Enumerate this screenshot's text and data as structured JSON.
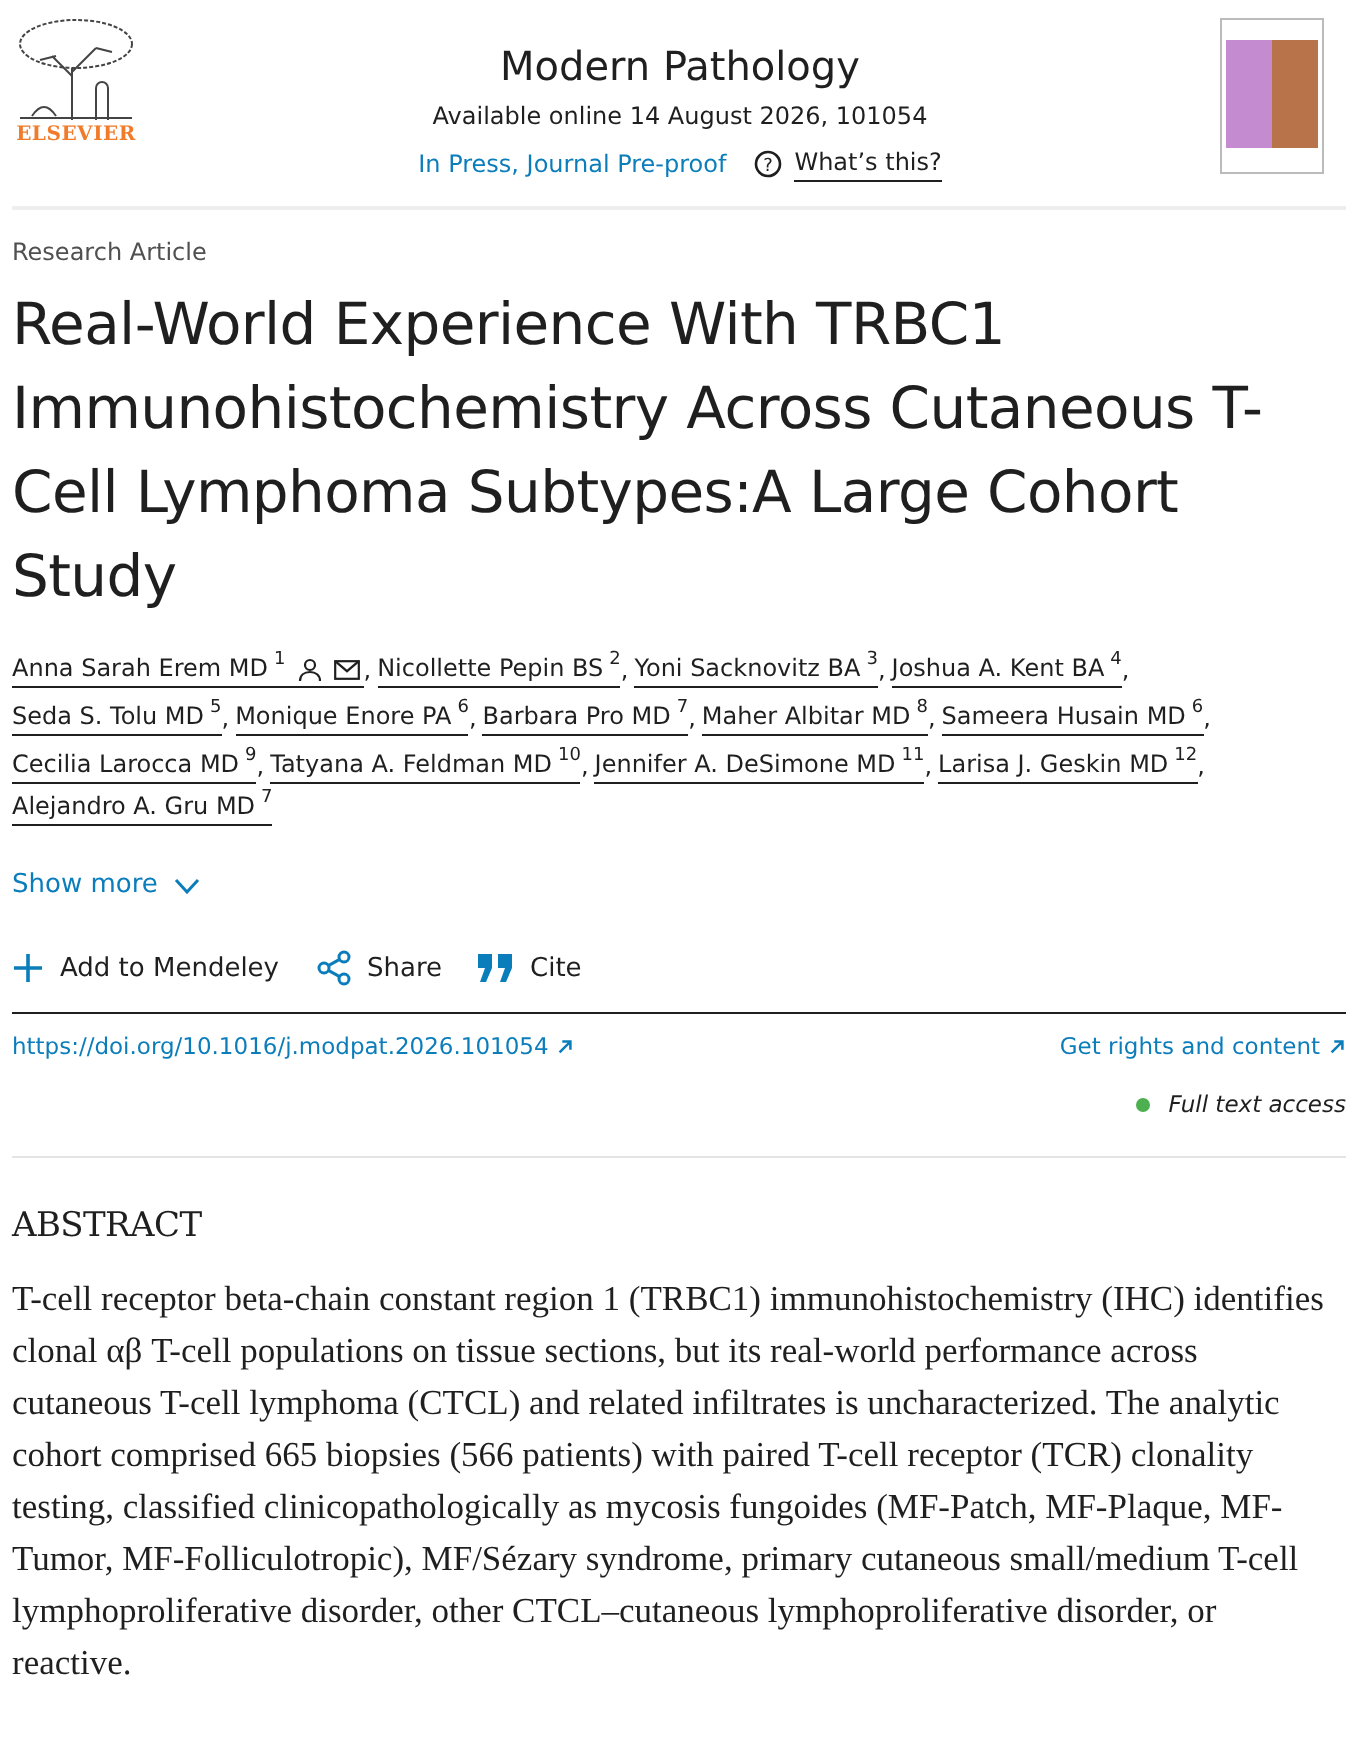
{
  "header": {
    "publisher": "ELSEVIER",
    "journal": "Modern Pathology",
    "availability": "Available online 14 August 2026, 101054",
    "status_link": "In Press, Journal Pre-proof",
    "help_icon": "?",
    "help_link": "What’s this?"
  },
  "author_separator": ",",
  "article": {
    "type": "Research Article",
    "title": "Real-World Experience With TRBC1 Immunohistochemistry Across Cutaneous T-Cell Lymphoma Subtypes:A Large Cohort Study"
  },
  "authors": [
    {
      "name": "Anna Sarah Erem MD",
      "affiliation": "1",
      "corresponding": true
    },
    {
      "name": "Nicollette Pepin BS",
      "affiliation": "2",
      "corresponding": false
    },
    {
      "name": "Yoni Sacknovitz BA",
      "affiliation": "3",
      "corresponding": false
    },
    {
      "name": "Joshua A. Kent BA",
      "affiliation": "4",
      "corresponding": false
    },
    {
      "name": "Seda S. Tolu MD",
      "affiliation": "5",
      "corresponding": false
    },
    {
      "name": "Monique Enore PA",
      "affiliation": "6",
      "corresponding": false
    },
    {
      "name": "Barbara Pro MD",
      "affiliation": "7",
      "corresponding": false
    },
    {
      "name": "Maher Albitar MD",
      "affiliation": "8",
      "corresponding": false
    },
    {
      "name": "Sameera Husain MD",
      "affiliation": "6",
      "corresponding": false
    },
    {
      "name": "Cecilia Larocca MD",
      "affiliation": "9",
      "corresponding": false
    },
    {
      "name": "Tatyana A. Feldman MD",
      "affiliation": "10",
      "corresponding": false
    },
    {
      "name": "Jennifer A. DeSimone MD",
      "affiliation": "11",
      "corresponding": false
    },
    {
      "name": "Larisa J. Geskin MD",
      "affiliation": "12",
      "corresponding": false
    },
    {
      "name": "Alejandro A. Gru MD",
      "affiliation": "7",
      "corresponding": false
    }
  ],
  "show_more": {
    "label": "Show more",
    "expanded": false
  },
  "actions": [
    {
      "kind": "add",
      "label": "Add to Mendeley"
    },
    {
      "kind": "share",
      "label": "Share"
    },
    {
      "kind": "cite",
      "label": "Cite"
    }
  ],
  "doi": "https://doi.org/10.1016/j.modpat.2026.101054",
  "rights_link": "Get rights and content",
  "access": {
    "label": "Full text access",
    "color": "#4caf50"
  },
  "abstract": {
    "heading": "ABSTRACT",
    "text": "T-cell receptor beta-chain constant region 1 (TRBC1) immunohistochemistry (IHC) identifies clonal αβ T-cell populations on tissue sections, but its real-world performance across cutaneous T-cell lymphoma (CTCL) and related infiltrates is uncharacterized. The analytic cohort comprised 665 biopsies (566 patients) with paired T-cell receptor (TCR) clonality testing, classified clinicopathologically as mycosis fungoides (MF-Patch, MF-Plaque, MF-Tumor, MF-Folliculotropic), MF/Sézary syndrome, primary cutaneous small/medium T-cell lymphoproliferative disorder, other CTCL–cutaneous lymphoproliferative disorder, or reactive."
  }
}
